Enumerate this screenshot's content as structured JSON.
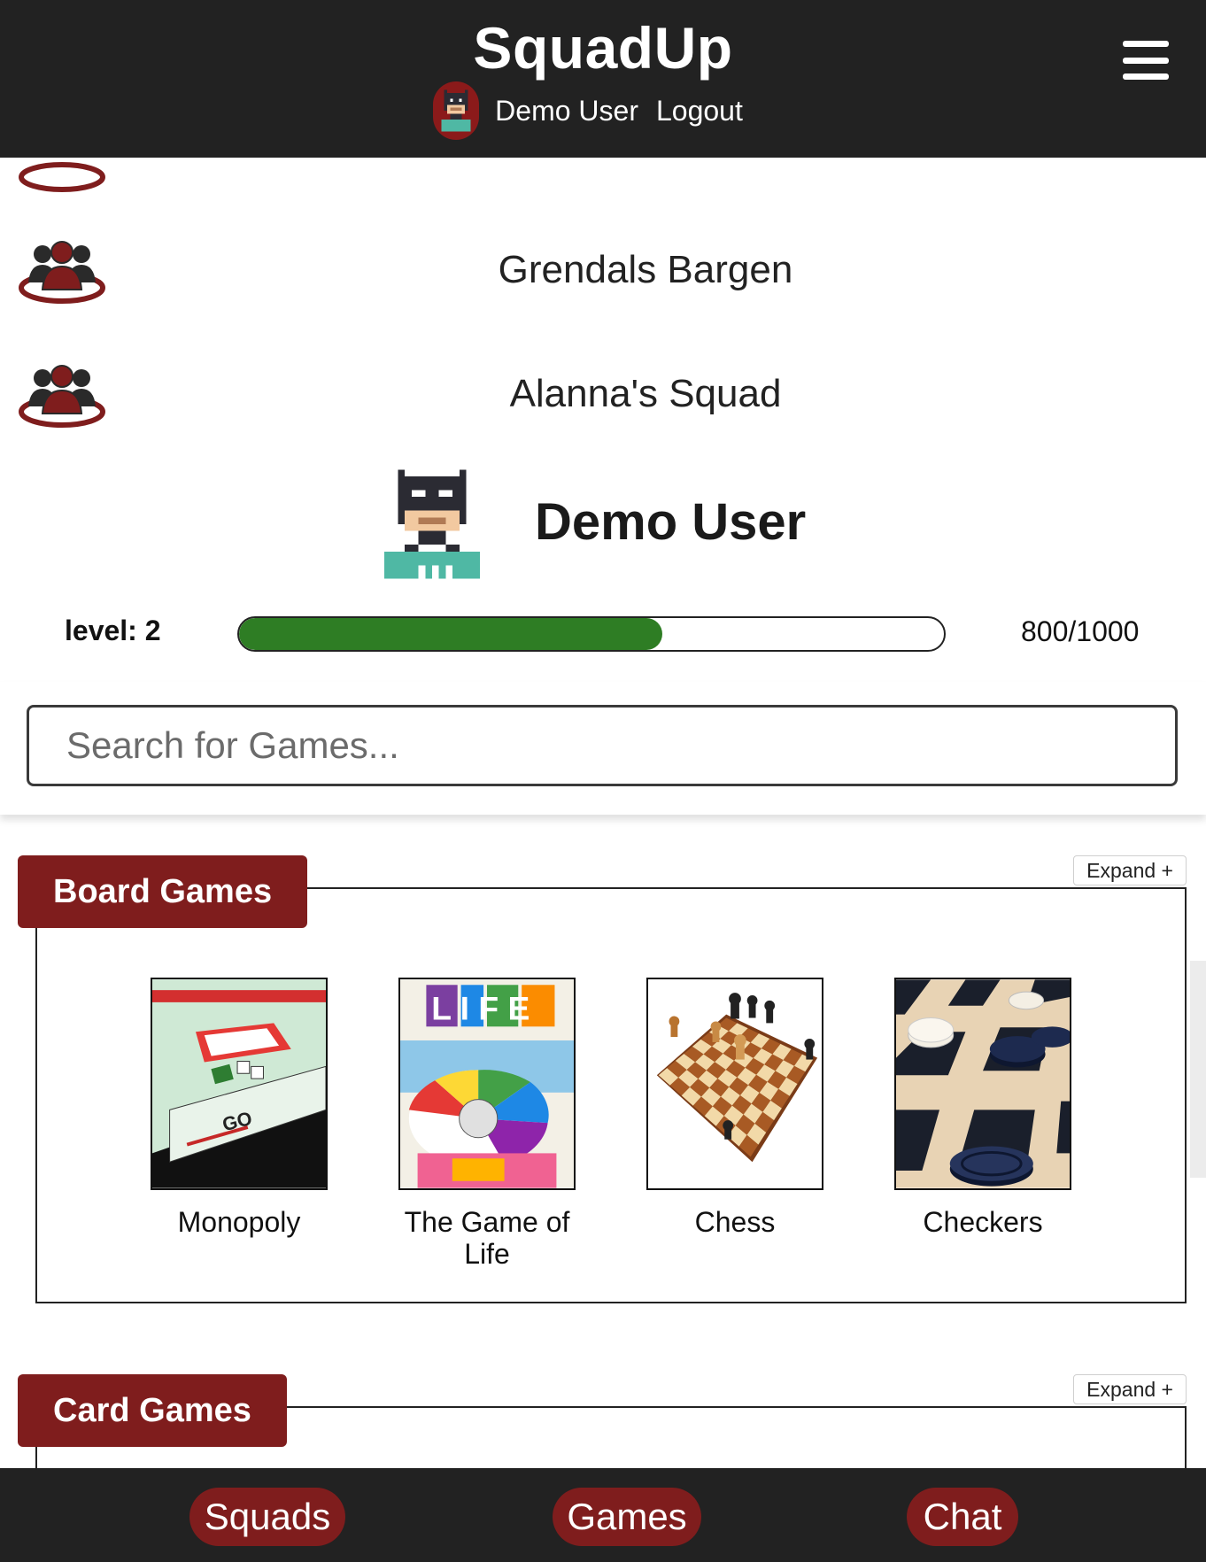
{
  "header": {
    "title": "SquadUp",
    "username": "Demo User",
    "logout": "Logout"
  },
  "squads": [
    {
      "name": "Grendals Bargen"
    },
    {
      "name": "Alanna's Squad"
    }
  ],
  "profile": {
    "name": "Demo User",
    "level_label": "level: 2",
    "xp_text": "800/1000",
    "progress_fraction": 0.6,
    "progress_color": "#2e7d24"
  },
  "search": {
    "placeholder": "Search for Games..."
  },
  "categories": [
    {
      "title": "Board Games",
      "expand_label": "Expand +",
      "games": [
        {
          "title": "Monopoly"
        },
        {
          "title": "The Game of Life"
        },
        {
          "title": "Chess"
        },
        {
          "title": "Checkers"
        }
      ]
    },
    {
      "title": "Card Games",
      "expand_label": "Expand +",
      "games": []
    }
  ],
  "nav": {
    "squads": "Squads",
    "games": "Games",
    "chat": "Chat"
  },
  "colors": {
    "brand_dark": "#222222",
    "accent_red": "#7f1d1d"
  }
}
